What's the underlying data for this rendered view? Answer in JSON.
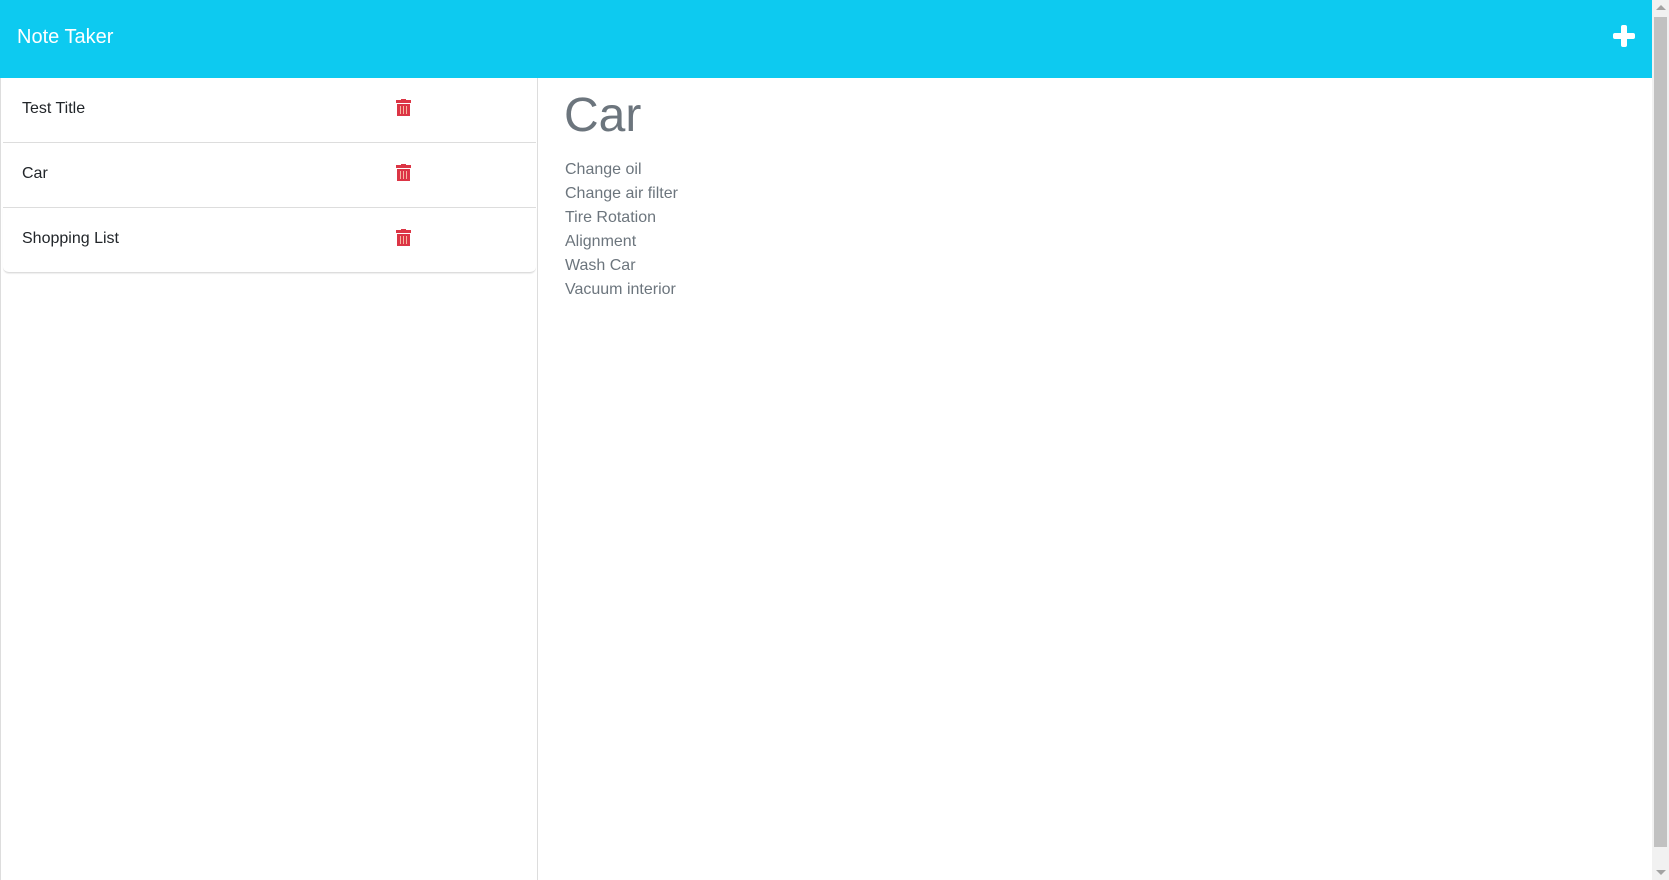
{
  "header": {
    "title": "Note Taker",
    "add_icon": "plus-icon",
    "color": "#0dcaf0"
  },
  "notes": [
    {
      "title": "Test Title",
      "delete_icon": "trash-icon"
    },
    {
      "title": "Car",
      "delete_icon": "trash-icon"
    },
    {
      "title": "Shopping List",
      "delete_icon": "trash-icon"
    }
  ],
  "active_note": {
    "title": "Car",
    "lines": [
      "Change oil",
      "Change air filter",
      "Tire Rotation",
      "Alignment",
      "Wash Car",
      "Vacuum interior"
    ]
  },
  "colors": {
    "delete": "#dc3545",
    "text_muted": "#6c757d"
  }
}
